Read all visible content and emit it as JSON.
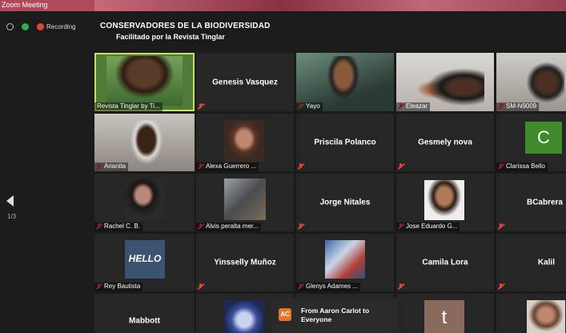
{
  "window": {
    "title": "Zoom Meeting"
  },
  "status": {
    "recording_label": "Recording"
  },
  "meeting": {
    "title": "CONSERVADORES  DE LA BIODIVERSIDAD",
    "subtitle": "Facilitado por la Revista Tinglar"
  },
  "pager": {
    "indicator": "1/3"
  },
  "colors": {
    "active_speaker": "#c8e05a",
    "muted_mic": "#e0453a",
    "avatar_green": "#3f8a2b",
    "chat_avatar": "#e8732c"
  },
  "tiles": [
    {
      "name": "Revista Tinglar by Ti..."
    },
    {
      "name": "Genesis Vasquez"
    },
    {
      "name": "Yayo"
    },
    {
      "name": "Eleazar"
    },
    {
      "name": "SM-N9009"
    },
    {
      "name": "Arianita"
    },
    {
      "name": "Alexa Guerrero ..."
    },
    {
      "name": "Priscila Polanco"
    },
    {
      "name": "Gesmely nova"
    },
    {
      "name": "Clarissa Bello",
      "avatar_letter": "C"
    },
    {
      "name": "Rachel C. B."
    },
    {
      "name": "Alvis peralta mer..."
    },
    {
      "name": "Jorge Nitales"
    },
    {
      "name": "Jose Eduardo G..."
    },
    {
      "name": "BCabrera"
    },
    {
      "name": "Rey Bautista",
      "image_text": "HELLO"
    },
    {
      "name": "Yinsselly Muñoz"
    },
    {
      "name": "Glenys Adames ..."
    },
    {
      "name": "Camila Lora"
    },
    {
      "name": "Kalil"
    },
    {
      "name": "Mabbott"
    },
    {
      "name": ""
    },
    {
      "name": ""
    },
    {
      "name": "",
      "avatar_letter": "t"
    },
    {
      "name": ""
    }
  ],
  "chat": {
    "sender_initials": "AC",
    "message": "From Aaron Carlot to Everyone"
  }
}
